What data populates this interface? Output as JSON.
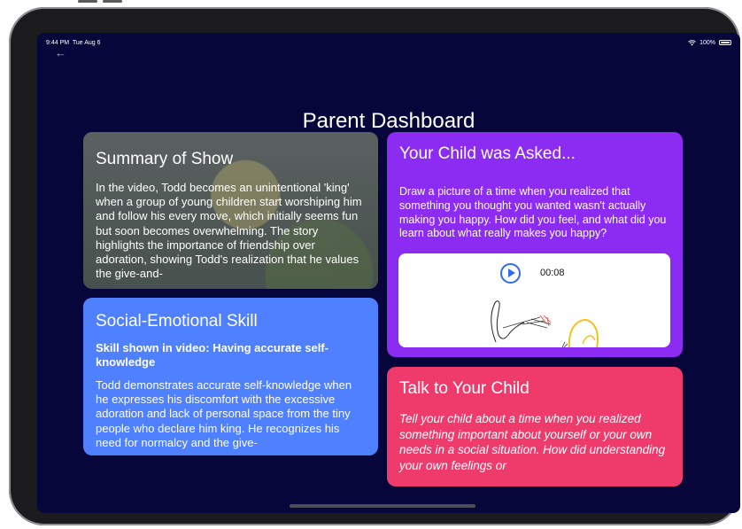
{
  "status": {
    "time": "9:44 PM",
    "date": "Tue Aug 6",
    "battery": "100%"
  },
  "page_title": "Parent Dashboard",
  "summary": {
    "title": "Summary of Show",
    "text": "In the video, Todd becomes an unintentional 'king' when a group of young children start worshiping him and follow his every move, which initially seems fun but soon becomes overwhelming. The story highlights the importance of friendship over adoration, showing Todd's realization that he values the give-and-"
  },
  "social": {
    "title": "Social-Emotional Skill",
    "subtitle": "Skill shown in video: Having accurate self-knowledge",
    "text": "Todd demonstrates accurate self-knowledge when he expresses his discomfort with the excessive adoration and lack of personal space from the tiny people who declare him king. He recognizes his need for normalcy and the give-"
  },
  "asked": {
    "title": "Your Child was Asked...",
    "text": "Draw a picture of a time when you realized that something you thought you wanted wasn't actually making you happy. How did you feel, and what did you learn about what really makes you happy?",
    "player_time": "00:08"
  },
  "talk": {
    "title": "Talk to Your Child",
    "text": "Tell your child about a time when you realized something important about yourself or your own needs in a social situation. How did understanding your own feelings or"
  },
  "colors": {
    "background": "#07063a",
    "summary_card": "#4a4e55",
    "social_card": "#4f80ff",
    "asked_card": "#8c2bf2",
    "talk_card": "#ef3a6c",
    "play_accent": "#2f6cf0"
  },
  "icons": {
    "back": "back-arrow-icon",
    "wifi": "wifi-icon",
    "battery": "battery-icon",
    "play": "play-icon"
  }
}
